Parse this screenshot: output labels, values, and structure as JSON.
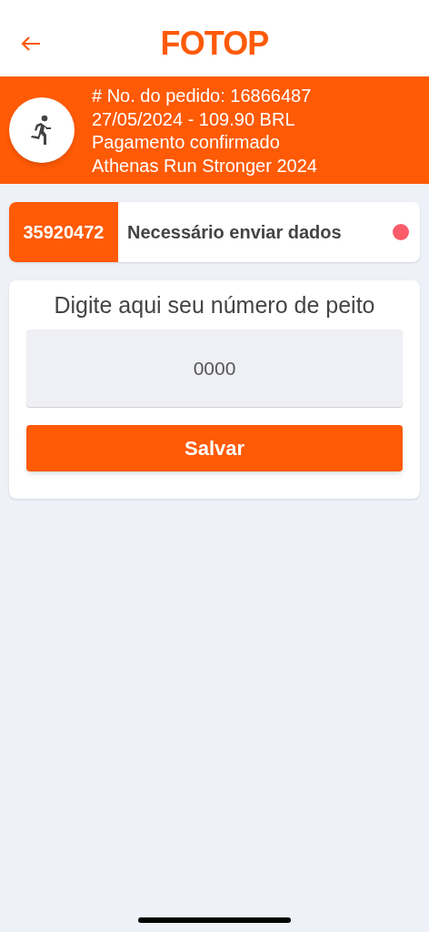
{
  "header": {
    "logo": "FOTOP"
  },
  "order": {
    "lines": [
      "# No. do pedido: 16866487",
      "27/05/2024 - 109.90 BRL",
      "Pagamento confirmado",
      "Athenas Run Stronger 2024"
    ]
  },
  "tickets": [
    {
      "number": "35920472",
      "status": "Necessário enviar dados",
      "color": "#fa5c6a"
    }
  ],
  "bib_form": {
    "title": "Digite aqui seu número de peito",
    "placeholder": "0000",
    "button": "Salvar"
  }
}
